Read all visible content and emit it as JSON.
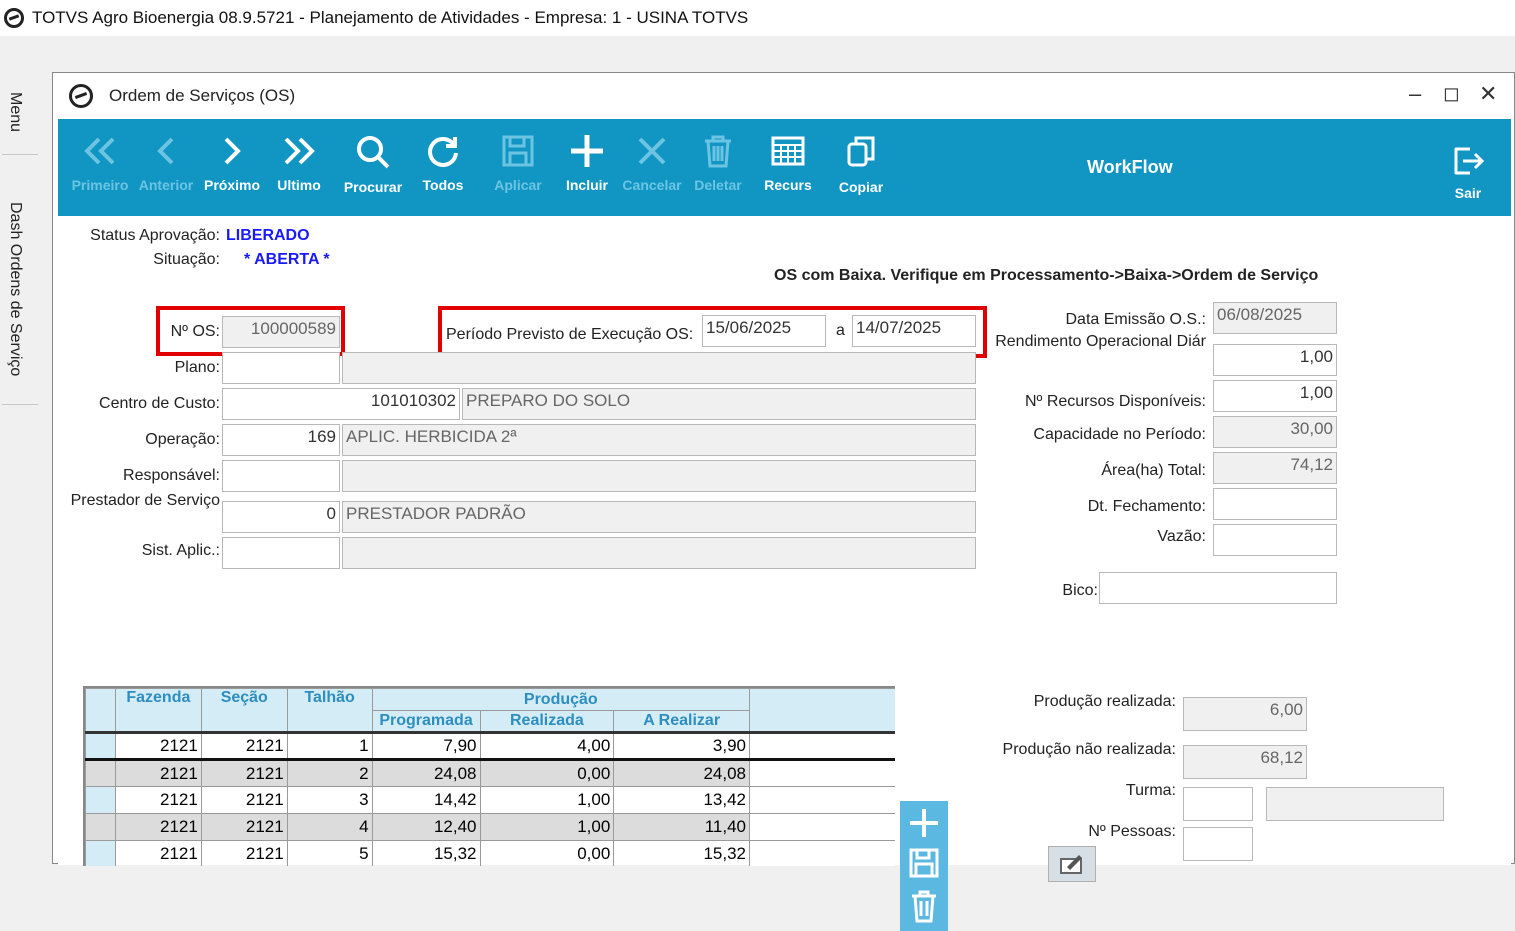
{
  "app_title": "TOTVS Agro Bioenergia 08.9.5721 - Planejamento de Atividades  - Empresa: 1 - USINA TOTVS",
  "sidebar": {
    "menu": "Menu",
    "dash": "Dash Ordens de Serviço"
  },
  "window": {
    "title": "Ordem de Serviços (OS)"
  },
  "toolbar": {
    "primeiro": "Primeiro",
    "anterior": "Anterior",
    "proximo": "Próximo",
    "ultimo": "Ultimo",
    "procurar": "Procurar",
    "todos": "Todos",
    "aplicar": "Aplicar",
    "incluir": "Incluir",
    "cancelar": "Cancelar",
    "deletar": "Deletar",
    "recurs": "Recurs",
    "copiar": "Copiar",
    "workflow": "WorkFlow",
    "sair": "Sair"
  },
  "status": {
    "aprovacao_label": "Status Aprovação:",
    "aprovacao_value": "LIBERADO",
    "situacao_label": "Situação:",
    "situacao_value": "* ABERTA *",
    "message": "OS com Baixa. Verifique em Processamento->Baixa->Ordem de Serviço"
  },
  "form": {
    "nos_label": "Nº OS:",
    "nos_value": "100000589",
    "periodo_label": "Período Previsto de Execução OS:",
    "periodo_inicio": "15/06/2025",
    "periodo_sep": "a",
    "periodo_fim": "14/07/2025",
    "plano_label": "Plano:",
    "cc_label": "Centro de Custo:",
    "cc_code": "101010302",
    "cc_desc": "PREPARO DO SOLO",
    "operacao_label": "Operação:",
    "operacao_code": "169",
    "operacao_desc": "APLIC. HERBICIDA 2ª",
    "responsavel_label": "Responsável:",
    "prestador_label": "Prestador de Serviço",
    "prestador_code": "0",
    "prestador_desc": "PRESTADOR PADRÃO",
    "sist_label": "Sist. Aplic.:"
  },
  "right": {
    "data_emissao_label": "Data Emissão O.S.:",
    "data_emissao_value": "06/08/2025",
    "rendimento_label": "Rendimento Operacional Diár",
    "rendimento_value": "1,00",
    "recursos_label": "Nº Recursos Disponíveis:",
    "recursos_value": "1,00",
    "capacidade_label": "Capacidade no Período:",
    "capacidade_value": "30,00",
    "area_label": "Área(ha) Total:",
    "area_value": "74,12",
    "fechamento_label": "Dt. Fechamento:",
    "vazao_label": "Vazão:",
    "bico_label": "Bico:",
    "prod_realizada_label": "Produção realizada:",
    "prod_realizada_value": "6,00",
    "prod_nao_realizada_label": "Produção não realizada:",
    "prod_nao_realizada_value": "68,12",
    "turma_label": "Turma:",
    "pessoas_label": "Nº Pessoas:"
  },
  "grid": {
    "headers": {
      "fazenda": "Fazenda",
      "secao": "Seção",
      "talhao": "Talhão",
      "producao": "Produção",
      "programada": "Programada",
      "realizada": "Realizada",
      "a_realizar": "A Realizar"
    },
    "rows": [
      [
        "2121",
        "2121",
        "1",
        "7,90",
        "4,00",
        "3,90"
      ],
      [
        "2121",
        "2121",
        "2",
        "24,08",
        "0,00",
        "24,08"
      ],
      [
        "2121",
        "2121",
        "3",
        "14,42",
        "1,00",
        "13,42"
      ],
      [
        "2121",
        "2121",
        "4",
        "12,40",
        "1,00",
        "11,40"
      ],
      [
        "2121",
        "2121",
        "5",
        "15,32",
        "0,00",
        "15,32"
      ]
    ]
  }
}
